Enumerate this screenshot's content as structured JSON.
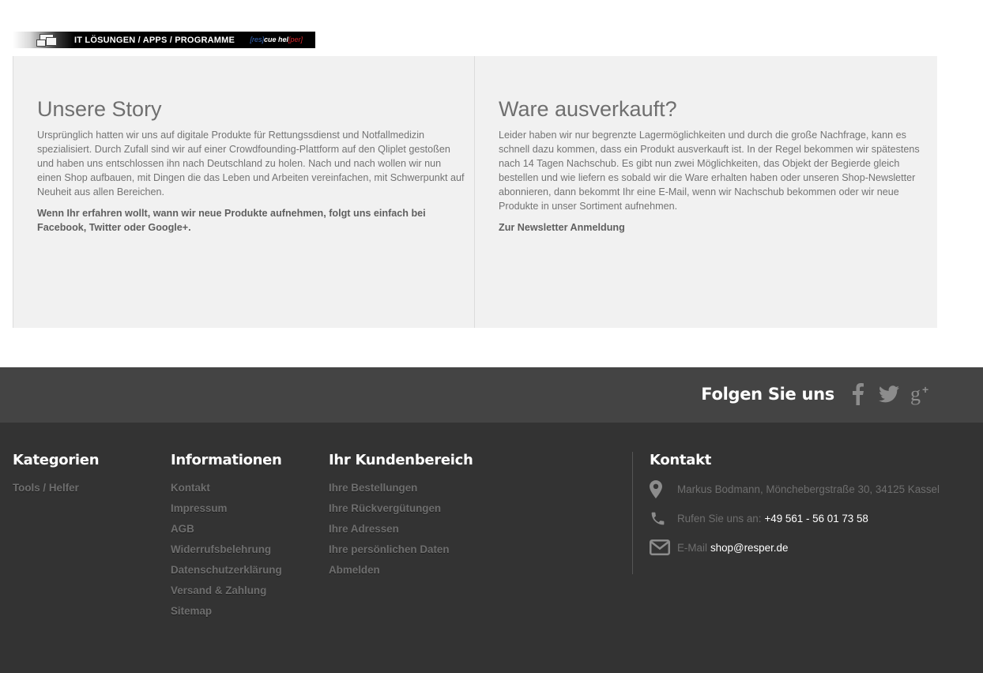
{
  "banner": {
    "text": "IT  LÖSUNGEN / APPS / PROGRAMME",
    "brand": {
      "part1": "[res]",
      "part2": "cue hel",
      "part3": "[per]"
    }
  },
  "story": {
    "title": "Unsere Story",
    "body": "Ursprünglich hatten wir uns auf digitale Produkte für Rettungssdienst und Notfallmedizin spezialisiert. Durch Zufall sind wir auf einer Crowdfounding-Plattform auf den Qliplet gestoßen und haben uns entschlossen ihn nach Deutschland zu holen. Nach und nach wollen wir nun einen Shop aufbauen, mit Dingen die das Leben und Arbeiten vereinfachen, mit Schwerpunkt auf Neuheit aus allen Bereichen.",
    "cta": "Wenn Ihr erfahren wollt, wann wir neue Produkte aufnehmen, folgt uns einfach bei Facebook, Twitter oder Google+."
  },
  "soldout": {
    "title": "Ware ausverkauft?",
    "body": "Leider haben wir nur begrenzte Lagermöglichkeiten und durch die große Nachfrage, kann es schnell dazu kommen, dass ein Produkt ausverkauft ist. In der Regel bekommen wir spätestens nach 14 Tagen Nachschub. Es gibt nun zwei Möglichkeiten, das Objekt der Begierde gleich bestellen und wie liefern es sobald wir die Ware erhalten haben oder unseren Shop-Newsletter abonnieren, dann bekommt Ihr eine E-Mail, wenn wir Nachschub bekommen oder wir neue Produkte in unser Sortiment aufnehmen.",
    "link": "Zur Newsletter Anmeldung"
  },
  "follow": {
    "label": "Folgen Sie uns",
    "icons": [
      "facebook-icon",
      "twitter-icon",
      "google-plus-icon"
    ]
  },
  "footer": {
    "kategorien": {
      "title": "Kategorien",
      "links": [
        "Tools / Helfer"
      ]
    },
    "informationen": {
      "title": "Informationen",
      "links": [
        "Kontakt",
        "Impressum",
        "AGB",
        "Widerrufsbelehrung",
        "Datenschutzerklärung",
        "Versand & Zahlung",
        "Sitemap"
      ]
    },
    "kundenbereich": {
      "title": "Ihr Kundenbereich",
      "links": [
        "Ihre Bestellungen",
        "Ihre Rückvergütungen",
        "Ihre Adressen",
        "Ihre persönlichen Daten",
        "Abmelden"
      ]
    },
    "kontakt": {
      "title": "Kontakt",
      "address": "Markus Bodmann, Mönchebergstraße 30, 34125 Kassel",
      "phone_label": "Rufen Sie uns an:",
      "phone": "+49 561 - 56 01 73 58",
      "email_label": "E-Mail",
      "email": "shop@resper.de"
    }
  },
  "colors": {
    "panel_bg": "#f1f1f1",
    "footer_top": "#444444",
    "footer": "#333333",
    "link": "#6e6e6e"
  }
}
